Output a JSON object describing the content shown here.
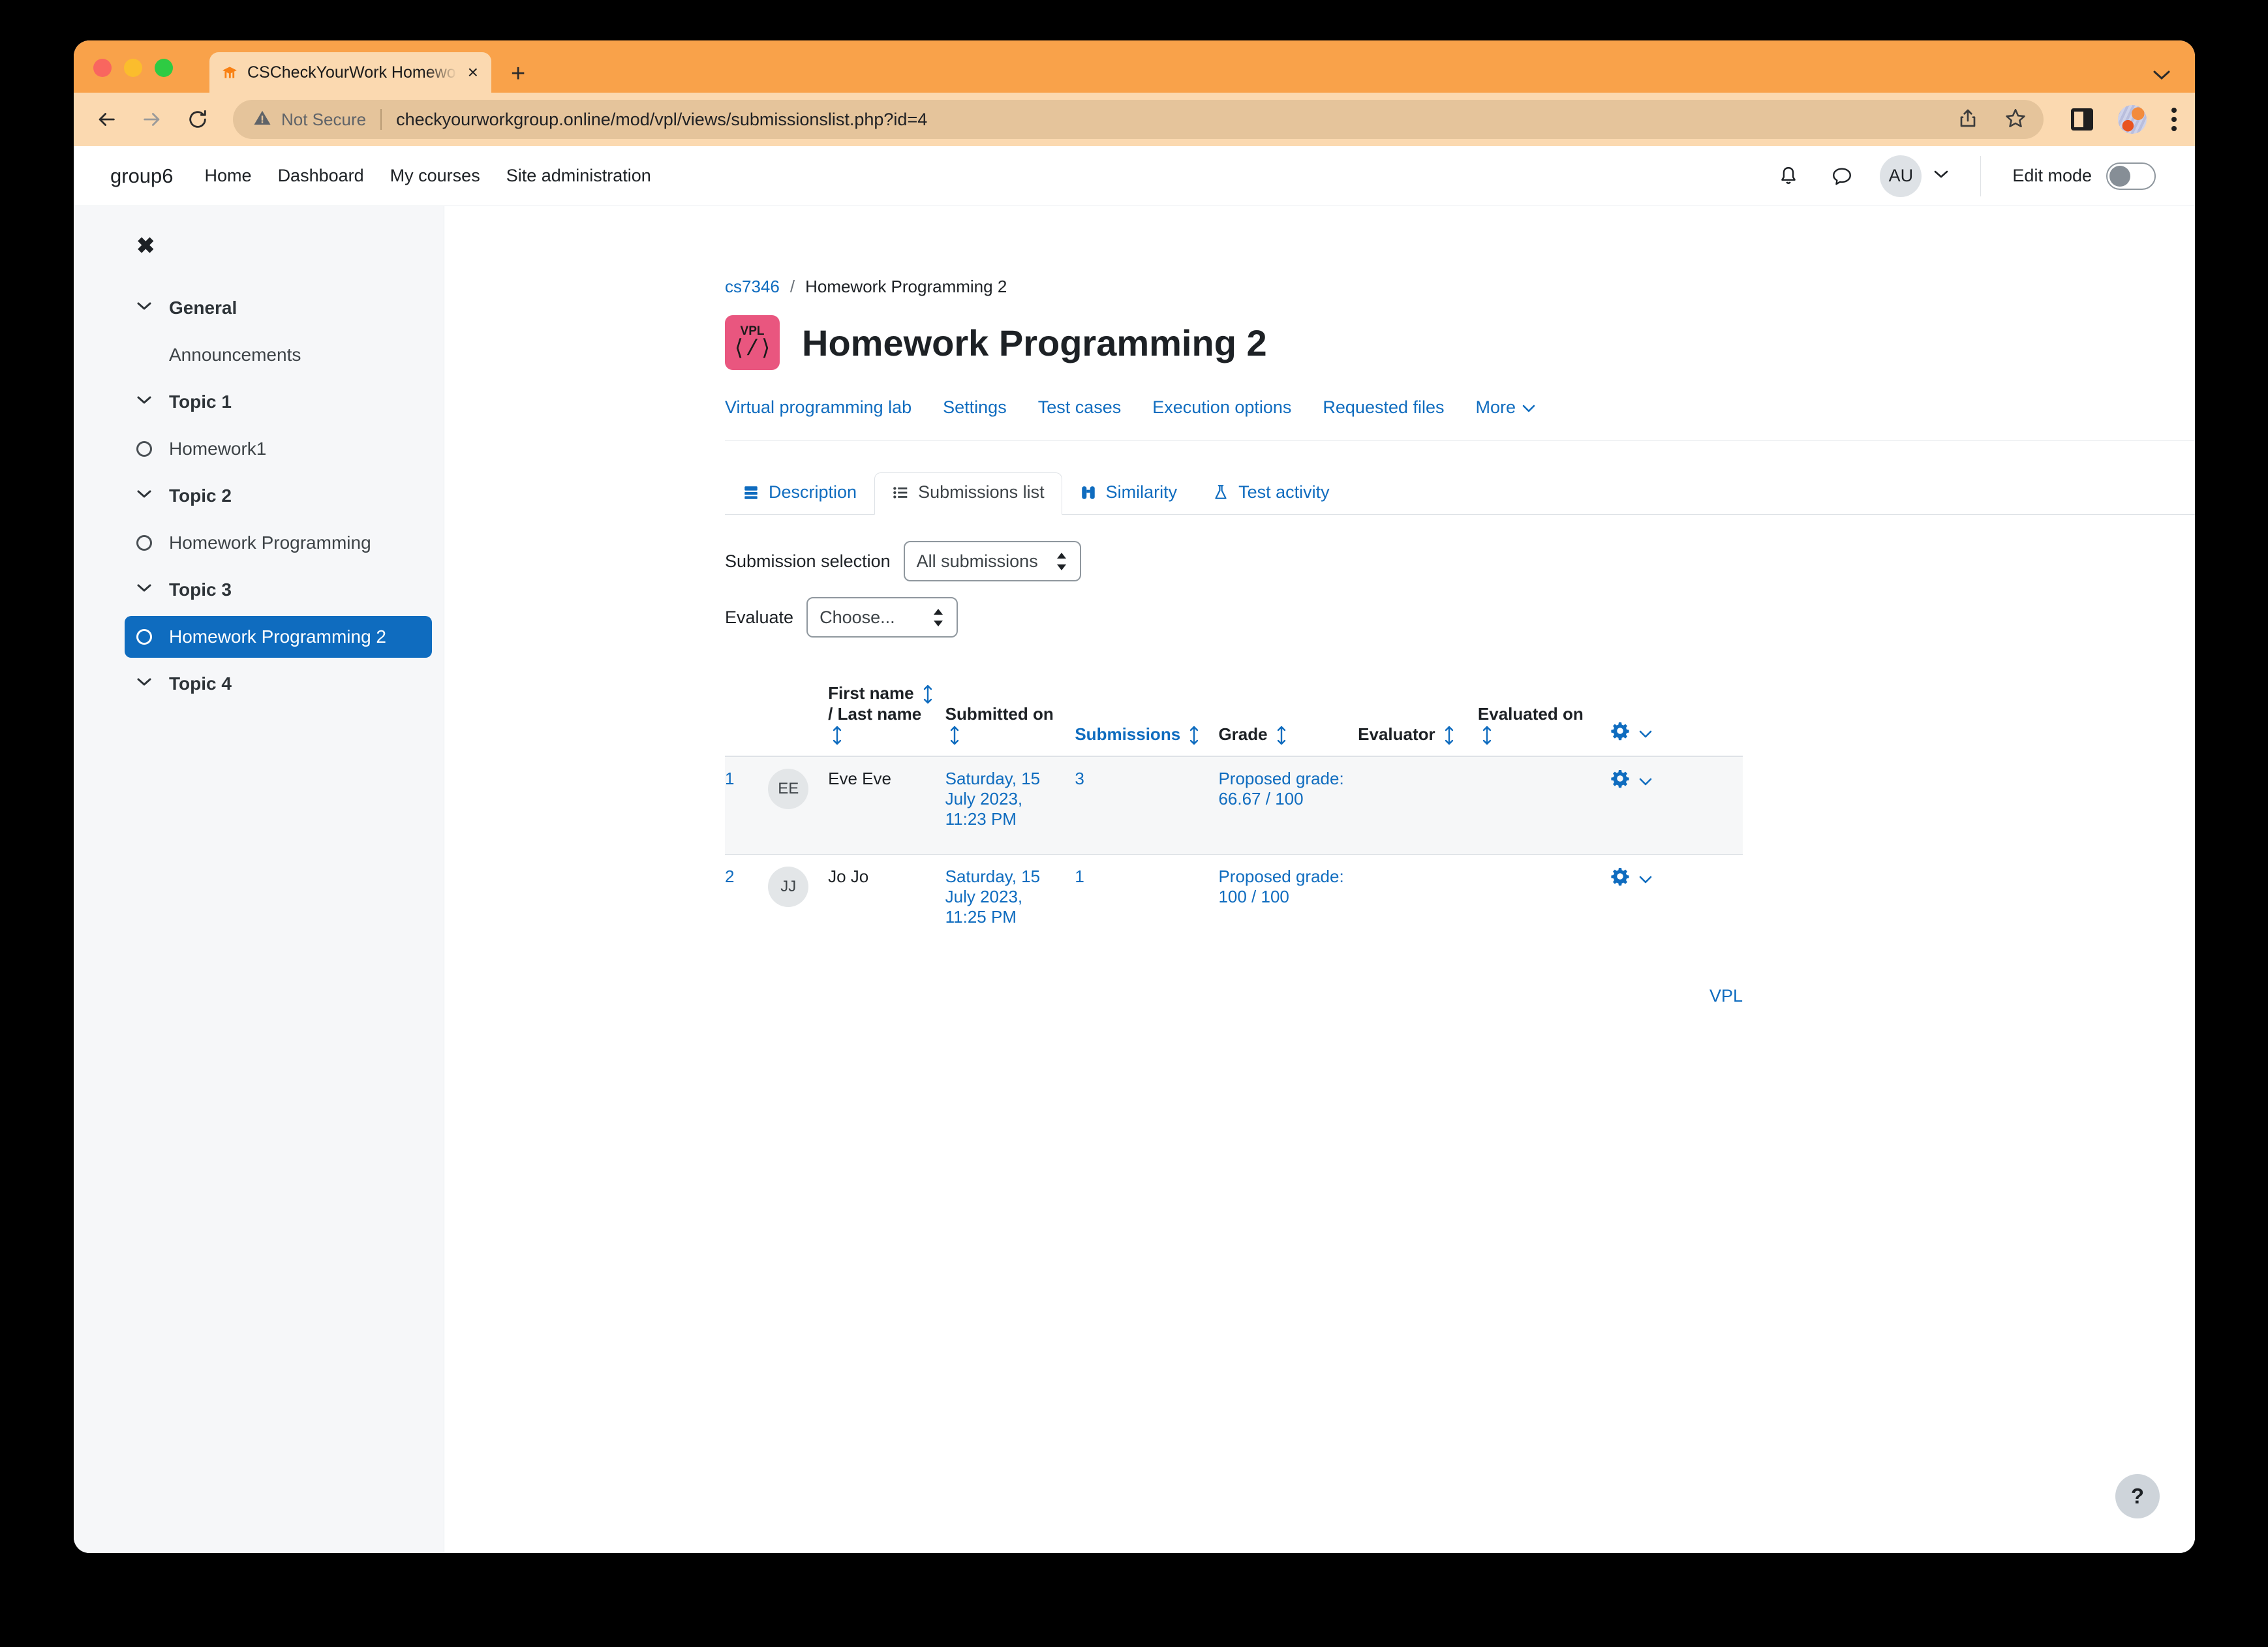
{
  "browser": {
    "tab_title": "CSCheckYourWork Homework",
    "tab_close_label": "×",
    "new_tab_label": "+",
    "security_label": "Not Secure",
    "url": "checkyourworkgroup.online/mod/vpl/views/submissionslist.php?id=4"
  },
  "navbar": {
    "brand": "group6",
    "links": [
      {
        "label": "Home"
      },
      {
        "label": "Dashboard"
      },
      {
        "label": "My courses"
      },
      {
        "label": "Site administration"
      }
    ],
    "avatar_initials": "AU",
    "edit_mode_label": "Edit mode",
    "edit_mode_on": false
  },
  "sidebar": {
    "close_label": "✖",
    "items": [
      {
        "type": "section",
        "label": "General"
      },
      {
        "type": "item_plain",
        "label": "Announcements"
      },
      {
        "type": "section",
        "label": "Topic 1"
      },
      {
        "type": "item",
        "label": "Homework1"
      },
      {
        "type": "section",
        "label": "Topic 2"
      },
      {
        "type": "item",
        "label": "Homework Programming"
      },
      {
        "type": "section",
        "label": "Topic 3"
      },
      {
        "type": "item_active",
        "label": "Homework Programming 2"
      },
      {
        "type": "section",
        "label": "Topic 4"
      }
    ]
  },
  "breadcrumb": {
    "course": "cs7346",
    "separator": "/",
    "current": "Homework Programming 2"
  },
  "header": {
    "icon_text": "VPL",
    "icon_code": "⟨/⟩",
    "icon_color": "#e9567f",
    "title": "Homework Programming 2"
  },
  "primary_tabs": [
    {
      "label": "Virtual programming lab"
    },
    {
      "label": "Settings"
    },
    {
      "label": "Test cases"
    },
    {
      "label": "Execution options"
    },
    {
      "label": "Requested files"
    },
    {
      "label": "More"
    }
  ],
  "secondary_tabs": [
    {
      "label": "Description",
      "icon": "description-icon",
      "active": false
    },
    {
      "label": "Submissions list",
      "icon": "list-icon",
      "active": true
    },
    {
      "label": "Similarity",
      "icon": "binoculars-icon",
      "active": false
    },
    {
      "label": "Test activity",
      "icon": "flask-icon",
      "active": false
    }
  ],
  "filters": {
    "submission_selection_label": "Submission selection",
    "submission_selection_value": "All submissions",
    "evaluate_label": "Evaluate",
    "evaluate_value": "Choose..."
  },
  "table": {
    "headers": {
      "num": "",
      "avatar": "",
      "name_first": "First name",
      "name_sep": "/",
      "name_last": "Last name",
      "submitted_on": "Submitted on",
      "submissions": "Submissions",
      "grade": "Grade",
      "evaluator": "Evaluator",
      "evaluated_on": "Evaluated on",
      "actions": ""
    },
    "rows": [
      {
        "num": "1",
        "initials": "EE",
        "name": "Eve Eve",
        "submitted_on": "Saturday, 15 July 2023, 11:23 PM",
        "submissions": "3",
        "grade": "Proposed grade: 66.67 / 100",
        "evaluator": "",
        "evaluated_on": "",
        "shaded": true
      },
      {
        "num": "2",
        "initials": "JJ",
        "name": "Jo Jo",
        "submitted_on": "Saturday, 15 July 2023, 11:25 PM",
        "submissions": "1",
        "grade": "Proposed grade: 100 / 100",
        "evaluator": "",
        "evaluated_on": "",
        "shaded": false
      }
    ]
  },
  "footer": {
    "vpl_link": "VPL"
  },
  "help": {
    "label": "?"
  },
  "colors": {
    "link": "#0f6cbf",
    "active_nav": "#0f6cbf",
    "vpl_pink": "#e9567f",
    "browser_orange": "#f9a24a"
  }
}
